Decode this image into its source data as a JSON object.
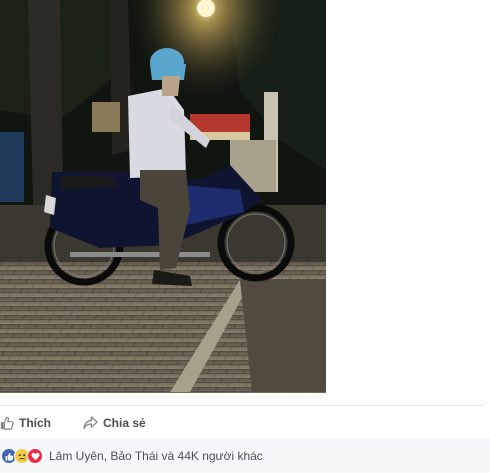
{
  "post": {
    "photo": {
      "icon": "motorbike-photo"
    },
    "actions": {
      "like_label": "Thích",
      "share_label": "Chia sẻ",
      "like_icon": "thumbs-up-icon",
      "share_icon": "share-arrow-icon"
    },
    "reactions": {
      "summary": "Lâm Uyên, Bảo Thái và 44K người khác",
      "icons": [
        "like-reaction-icon",
        "sad-reaction-icon",
        "love-reaction-icon"
      ],
      "colors": {
        "like": "#4267b2",
        "sad": "#f7cc45",
        "love": "#f0284a"
      }
    }
  }
}
